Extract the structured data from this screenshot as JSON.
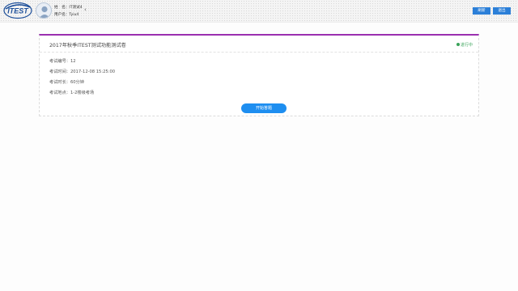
{
  "header": {
    "logo_text": "ITEST",
    "user": {
      "name_label": "姓　名：",
      "name_value": "IT测试4",
      "username_label": "用户名：",
      "username_value": "Tyiu4"
    },
    "collapse_icon": "chevron-left-icon",
    "refresh_label": "刷新",
    "logout_label": "退出",
    "button_color": "#2b7fd8"
  },
  "exam": {
    "title": "2017年秋季ITEST测试功能测试卷",
    "status": "进行中",
    "status_color": "#3aa35a",
    "accent_color": "#9b2fb0",
    "fields": [
      {
        "label": "考试编号：",
        "value": "12"
      },
      {
        "label": "考试时间：",
        "value": "2017-12-08 15:25:00"
      },
      {
        "label": "考试时长：",
        "value": "60分钟"
      },
      {
        "label": "考试地点：",
        "value": "1-2楼级考场"
      }
    ],
    "start_button_label": "开始答题",
    "start_button_color": "#1e8ef0"
  }
}
